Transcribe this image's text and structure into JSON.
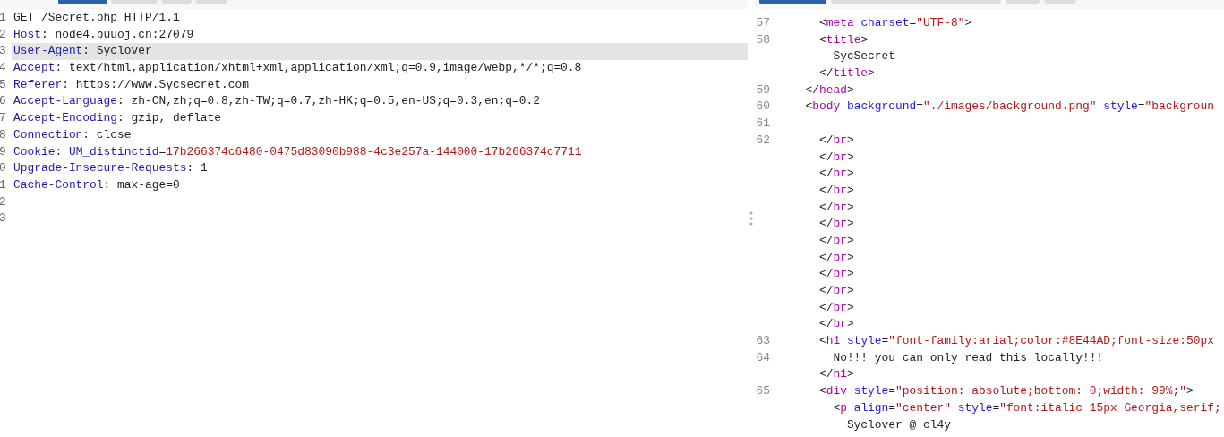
{
  "request": {
    "tabs": [
      {
        "selected": true
      },
      {
        "selected": false
      },
      {
        "selected": false
      },
      {
        "selected": false
      }
    ],
    "lines": [
      {
        "number": "1",
        "selected": false,
        "segments": [
          {
            "kind": "plain",
            "text": "GET /Secret.php HTTP/1.1"
          }
        ]
      },
      {
        "number": "2",
        "selected": false,
        "segments": [
          {
            "kind": "header",
            "text": "Host"
          },
          {
            "kind": "plain",
            "text": ": node4.buuoj.cn:27079"
          }
        ]
      },
      {
        "number": "3",
        "selected": true,
        "segments": [
          {
            "kind": "header",
            "text": "User-Agent"
          },
          {
            "kind": "plain",
            "text": ": Syclover"
          }
        ]
      },
      {
        "number": "4",
        "selected": false,
        "segments": [
          {
            "kind": "header",
            "text": "Accept"
          },
          {
            "kind": "plain",
            "text": ": text/html,application/xhtml+xml,application/xml;q=0.9,image/webp,*/*;q=0.8"
          }
        ]
      },
      {
        "number": "5",
        "selected": false,
        "segments": [
          {
            "kind": "header",
            "text": "Referer"
          },
          {
            "kind": "plain",
            "text": ": https://www.Sycsecret.com"
          }
        ]
      },
      {
        "number": "6",
        "selected": false,
        "segments": [
          {
            "kind": "header",
            "text": "Accept-Language"
          },
          {
            "kind": "plain",
            "text": ": zh-CN,zh;q=0.8,zh-TW;q=0.7,zh-HK;q=0.5,en-US;q=0.3,en;q=0.2"
          }
        ]
      },
      {
        "number": "7",
        "selected": false,
        "segments": [
          {
            "kind": "header",
            "text": "Accept-Encoding"
          },
          {
            "kind": "plain",
            "text": ": gzip, deflate"
          }
        ]
      },
      {
        "number": "8",
        "selected": false,
        "segments": [
          {
            "kind": "header",
            "text": "Connection"
          },
          {
            "kind": "plain",
            "text": ": close"
          }
        ]
      },
      {
        "number": "9",
        "selected": false,
        "segments": [
          {
            "kind": "header",
            "text": "Cookie"
          },
          {
            "kind": "plain",
            "text": ": "
          },
          {
            "kind": "header",
            "text": "UM_distinctid"
          },
          {
            "kind": "plain",
            "text": "="
          },
          {
            "kind": "value",
            "text": "17b266374c6480-0475d83090b988-4c3e257a-144000-17b266374c7711"
          }
        ]
      },
      {
        "number": "0",
        "selected": false,
        "segments": [
          {
            "kind": "header",
            "text": "Upgrade-Insecure-Requests"
          },
          {
            "kind": "plain",
            "text": ": 1"
          }
        ]
      },
      {
        "number": "1",
        "selected": false,
        "segments": [
          {
            "kind": "header",
            "text": "Cache-Control"
          },
          {
            "kind": "plain",
            "text": ": max-age=0"
          }
        ]
      },
      {
        "number": "2",
        "selected": false
      },
      {
        "number": "3",
        "selected": false
      }
    ]
  },
  "response": {
    "tabs": [
      {
        "selected": true
      },
      {
        "selected": false
      },
      {
        "selected": false
      },
      {
        "selected": false
      }
    ],
    "lines": [
      {
        "number": "57",
        "segments": [
          {
            "kind": "plain",
            "text": "    <"
          },
          {
            "kind": "tag",
            "text": "meta"
          },
          {
            "kind": "attr",
            "text": " charset"
          },
          {
            "kind": "plain",
            "text": "="
          },
          {
            "kind": "string",
            "text": "\"UTF-8\""
          },
          {
            "kind": "plain",
            "text": ">"
          }
        ]
      },
      {
        "number": "58",
        "segments": [
          {
            "kind": "plain",
            "text": "    <"
          },
          {
            "kind": "tag",
            "text": "title"
          },
          {
            "kind": "plain",
            "text": ">"
          }
        ]
      },
      {
        "segments": [
          {
            "kind": "plain",
            "text": "      SycSecret"
          }
        ]
      },
      {
        "segments": [
          {
            "kind": "plain",
            "text": "    </"
          },
          {
            "kind": "tag",
            "text": "title"
          },
          {
            "kind": "plain",
            "text": ">"
          }
        ]
      },
      {
        "number": "59",
        "segments": [
          {
            "kind": "plain",
            "text": "  </"
          },
          {
            "kind": "tag",
            "text": "head"
          },
          {
            "kind": "plain",
            "text": ">"
          }
        ]
      },
      {
        "number": "60",
        "segments": [
          {
            "kind": "plain",
            "text": "  <"
          },
          {
            "kind": "tag",
            "text": "body"
          },
          {
            "kind": "attr",
            "text": " background"
          },
          {
            "kind": "plain",
            "text": "="
          },
          {
            "kind": "string",
            "text": "\"./images/background.png\""
          },
          {
            "kind": "attr",
            "text": " style"
          },
          {
            "kind": "plain",
            "text": "="
          },
          {
            "kind": "string",
            "text": "\"backgroun"
          }
        ]
      },
      {
        "number": "61"
      },
      {
        "number": "62",
        "segments": [
          {
            "kind": "plain",
            "text": "    </"
          },
          {
            "kind": "tag",
            "text": "br"
          },
          {
            "kind": "plain",
            "text": ">"
          }
        ]
      },
      {
        "segments": [
          {
            "kind": "plain",
            "text": "    </"
          },
          {
            "kind": "tag",
            "text": "br"
          },
          {
            "kind": "plain",
            "text": ">"
          }
        ]
      },
      {
        "segments": [
          {
            "kind": "plain",
            "text": "    </"
          },
          {
            "kind": "tag",
            "text": "br"
          },
          {
            "kind": "plain",
            "text": ">"
          }
        ]
      },
      {
        "segments": [
          {
            "kind": "plain",
            "text": "    </"
          },
          {
            "kind": "tag",
            "text": "br"
          },
          {
            "kind": "plain",
            "text": ">"
          }
        ]
      },
      {
        "segments": [
          {
            "kind": "plain",
            "text": "    </"
          },
          {
            "kind": "tag",
            "text": "br"
          },
          {
            "kind": "plain",
            "text": ">"
          }
        ]
      },
      {
        "segments": [
          {
            "kind": "plain",
            "text": "    </"
          },
          {
            "kind": "tag",
            "text": "br"
          },
          {
            "kind": "plain",
            "text": ">"
          }
        ]
      },
      {
        "segments": [
          {
            "kind": "plain",
            "text": "    </"
          },
          {
            "kind": "tag",
            "text": "br"
          },
          {
            "kind": "plain",
            "text": ">"
          }
        ]
      },
      {
        "segments": [
          {
            "kind": "plain",
            "text": "    </"
          },
          {
            "kind": "tag",
            "text": "br"
          },
          {
            "kind": "plain",
            "text": ">"
          }
        ]
      },
      {
        "segments": [
          {
            "kind": "plain",
            "text": "    </"
          },
          {
            "kind": "tag",
            "text": "br"
          },
          {
            "kind": "plain",
            "text": ">"
          }
        ]
      },
      {
        "segments": [
          {
            "kind": "plain",
            "text": "    </"
          },
          {
            "kind": "tag",
            "text": "br"
          },
          {
            "kind": "plain",
            "text": ">"
          }
        ]
      },
      {
        "segments": [
          {
            "kind": "plain",
            "text": "    </"
          },
          {
            "kind": "tag",
            "text": "br"
          },
          {
            "kind": "plain",
            "text": ">"
          }
        ]
      },
      {
        "segments": [
          {
            "kind": "plain",
            "text": "    </"
          },
          {
            "kind": "tag",
            "text": "br"
          },
          {
            "kind": "plain",
            "text": ">"
          }
        ]
      },
      {
        "number": "63",
        "segments": [
          {
            "kind": "plain",
            "text": "    <"
          },
          {
            "kind": "tag",
            "text": "h1"
          },
          {
            "kind": "attr",
            "text": " style"
          },
          {
            "kind": "plain",
            "text": "="
          },
          {
            "kind": "string",
            "text": "\"font-family:arial;color:#8E44AD;font-size:50px"
          }
        ]
      },
      {
        "number": "64",
        "segments": [
          {
            "kind": "plain",
            "text": "      No!!! you can only read this locally!!!"
          }
        ]
      },
      {
        "segments": [
          {
            "kind": "plain",
            "text": "    </"
          },
          {
            "kind": "tag",
            "text": "h1"
          },
          {
            "kind": "plain",
            "text": ">"
          }
        ]
      },
      {
        "number": "65",
        "segments": [
          {
            "kind": "plain",
            "text": "    <"
          },
          {
            "kind": "tag",
            "text": "div"
          },
          {
            "kind": "attr",
            "text": " style"
          },
          {
            "kind": "plain",
            "text": "="
          },
          {
            "kind": "string",
            "text": "\"position: absolute;bottom: 0;width: 99%;\""
          },
          {
            "kind": "plain",
            "text": ">"
          }
        ]
      },
      {
        "segments": [
          {
            "kind": "plain",
            "text": "      <"
          },
          {
            "kind": "tag",
            "text": "p"
          },
          {
            "kind": "attr",
            "text": " align"
          },
          {
            "kind": "plain",
            "text": "="
          },
          {
            "kind": "string",
            "text": "\"center\""
          },
          {
            "kind": "attr",
            "text": " style"
          },
          {
            "kind": "plain",
            "text": "="
          },
          {
            "kind": "string",
            "text": "\"font:italic 15px Georgia,serif;"
          }
        ]
      },
      {
        "segments": [
          {
            "kind": "plain",
            "text": "        Syclover @ cl4y"
          }
        ]
      }
    ]
  }
}
